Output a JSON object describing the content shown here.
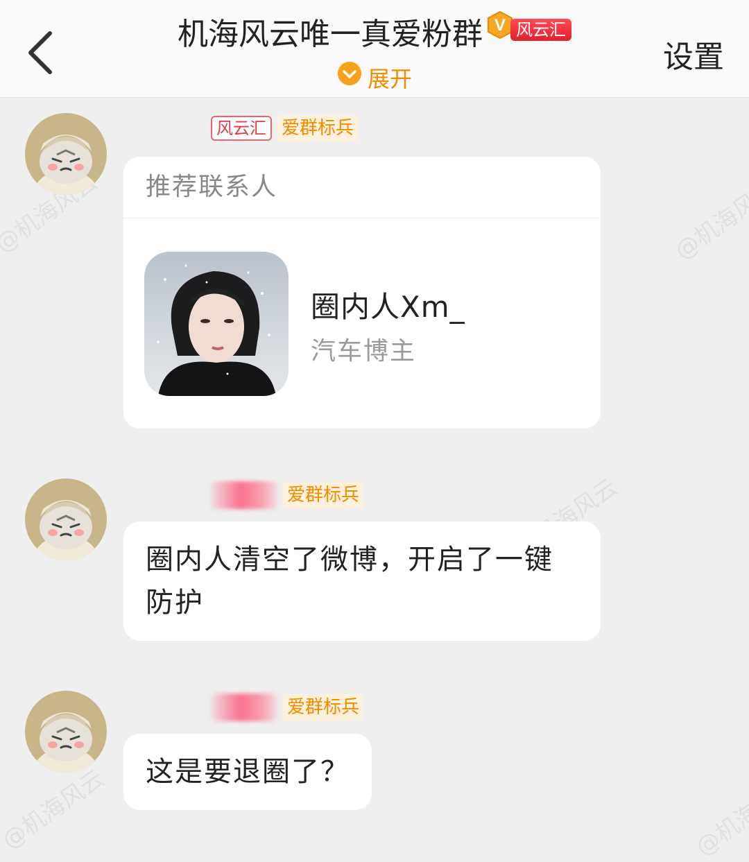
{
  "header": {
    "title": "机海风云唯一真爱粉群",
    "group_tag": "风云汇",
    "expand_label": "展开",
    "settings_label": "设置"
  },
  "watermark_text": "@机海风云",
  "messages": [
    {
      "sender_tag": "风云汇",
      "role_badge": "爱群标兵",
      "type": "contact_card",
      "card": {
        "header": "推荐联系人",
        "name": "圈内人Xm_",
        "description": "汽车博主"
      }
    },
    {
      "role_badge": "爱群标兵",
      "type": "text",
      "text": "圈内人清空了微博，开启了一键防护"
    },
    {
      "role_badge": "爱群标兵",
      "type": "text",
      "text": "这是要退圈了？"
    }
  ]
}
